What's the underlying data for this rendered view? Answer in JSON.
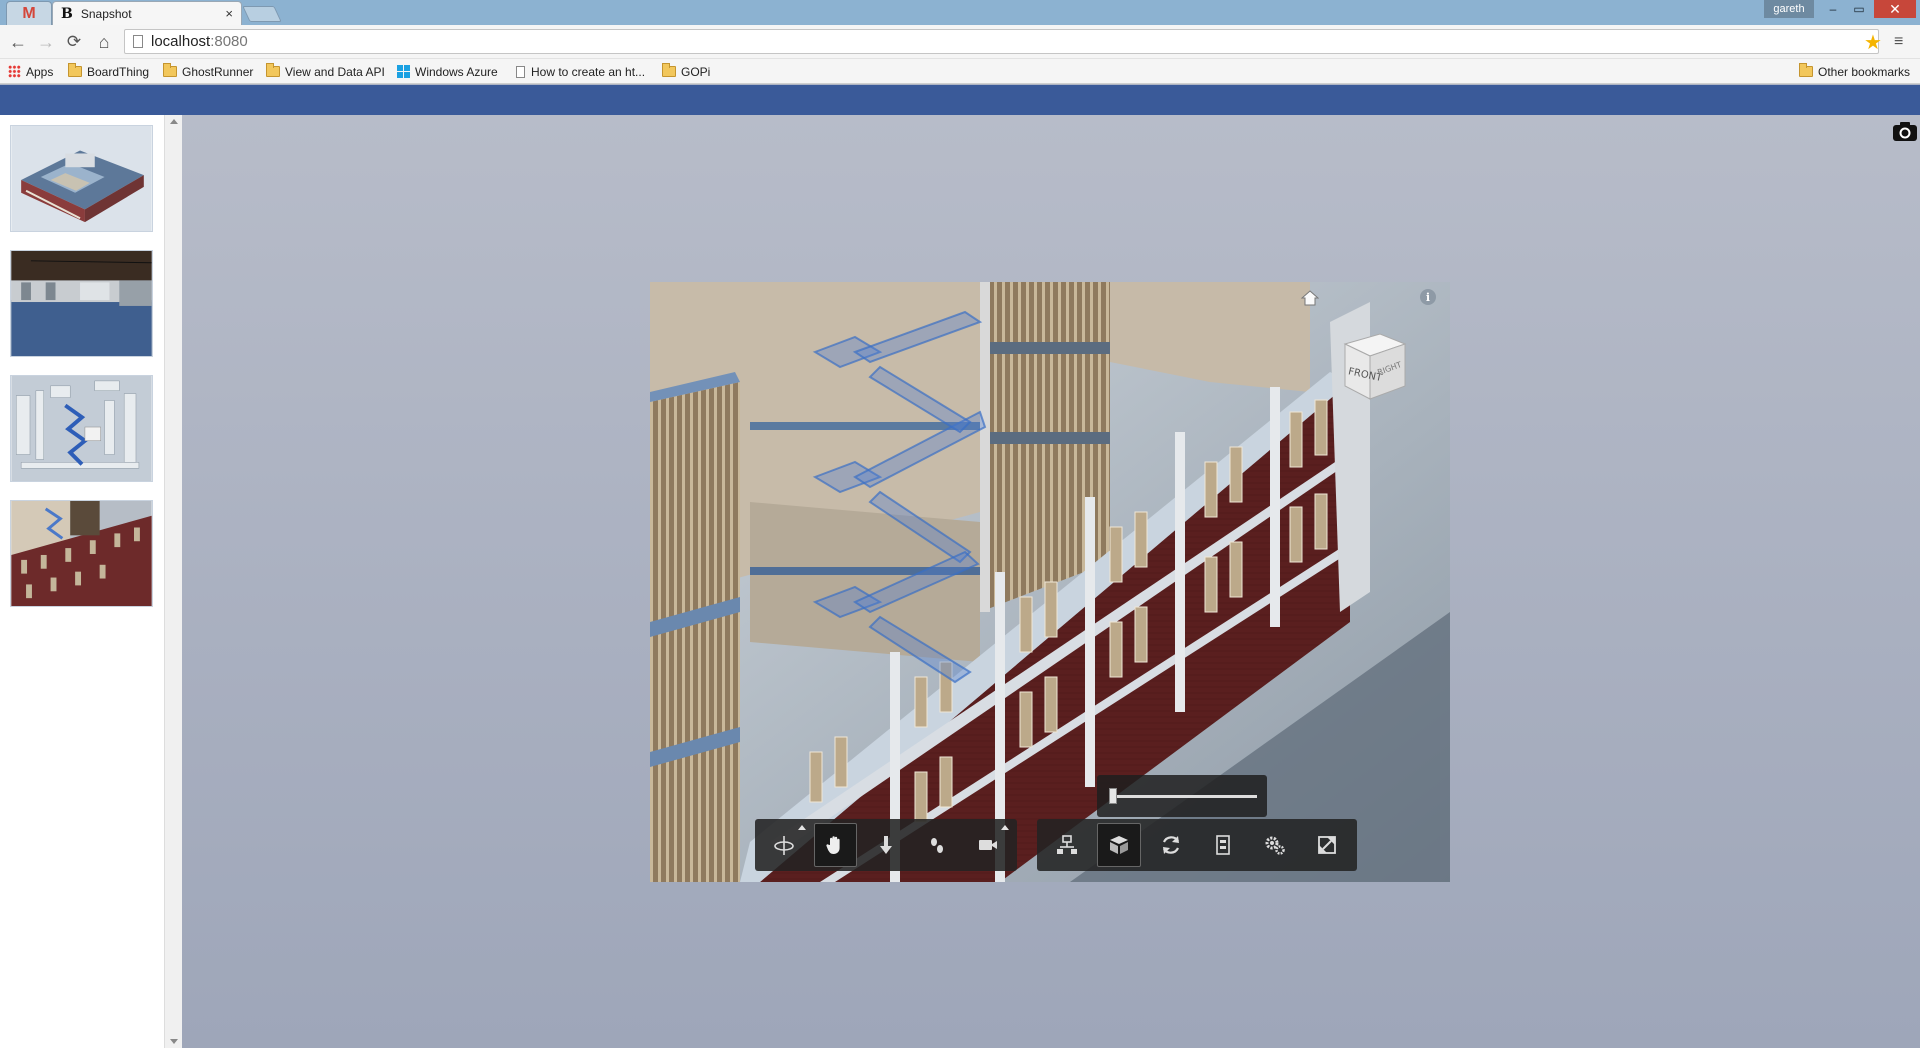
{
  "browser": {
    "tabs": [
      {
        "icon": "gmail-icon",
        "title": "M"
      },
      {
        "icon": "snapshot-favicon",
        "favicon": "B",
        "title": "Snapshot",
        "close": "×"
      }
    ],
    "profile_name": "gareth",
    "window_controls": {
      "minimize": "–",
      "restore": "▭",
      "close": "✕"
    },
    "url": {
      "host": "localhost",
      "port": ":8080"
    },
    "bookmarks": [
      {
        "icon": "apps-grid-icon",
        "label": "Apps"
      },
      {
        "icon": "folder-icon",
        "label": "BoardThing"
      },
      {
        "icon": "folder-icon",
        "label": "GhostRunner"
      },
      {
        "icon": "folder-icon",
        "label": "View and Data API"
      },
      {
        "icon": "windows-logo-icon",
        "label": "Windows Azure"
      },
      {
        "icon": "page-icon",
        "label": "How to create an ht..."
      },
      {
        "icon": "folder-icon",
        "label": "GOPi"
      },
      {
        "icon": "folder-icon",
        "label": "Other bookmarks"
      }
    ],
    "nav_icons": {
      "back": "←",
      "forward": "→",
      "reload": "⟳",
      "home": "⌂",
      "star": "★",
      "menu": "≡"
    }
  },
  "app": {
    "snapshots": [
      {
        "name": "snapshot-1",
        "view": "aerial building overview"
      },
      {
        "name": "snapshot-2",
        "view": "interior floor"
      },
      {
        "name": "snapshot-3",
        "view": "stair structure"
      },
      {
        "name": "snapshot-4",
        "view": "facade with stairs"
      }
    ],
    "viewer": {
      "viewcube_faces": {
        "front": "FRONT",
        "right": "RIGHT"
      },
      "info_label": "i",
      "explode_slider_value": 0.0,
      "toolbar_left": [
        {
          "name": "orbit-tool",
          "icon": "orbit-icon",
          "has_flyout": true,
          "active": false
        },
        {
          "name": "pan-tool",
          "icon": "hand-icon",
          "has_flyout": false,
          "active": true
        },
        {
          "name": "zoom-tool",
          "icon": "zoom-arrow-icon",
          "has_flyout": false,
          "active": false
        },
        {
          "name": "first-person-tool",
          "icon": "walk-icon",
          "has_flyout": false,
          "active": false
        },
        {
          "name": "camera-tool",
          "icon": "video-camera-icon",
          "has_flyout": true,
          "active": false
        }
      ],
      "toolbar_right": [
        {
          "name": "model-structure-tool",
          "icon": "structure-icon",
          "active": false
        },
        {
          "name": "explode-tool",
          "icon": "explode-cube-icon",
          "active": true
        },
        {
          "name": "reset-tool",
          "icon": "refresh-icon",
          "active": false
        },
        {
          "name": "properties-tool",
          "icon": "properties-icon",
          "active": false
        },
        {
          "name": "settings-tool",
          "icon": "gears-icon",
          "active": false
        },
        {
          "name": "fullscreen-tool",
          "icon": "fullscreen-icon",
          "active": false
        }
      ]
    }
  },
  "colors": {
    "app_header": "#3a5a99",
    "background": "#adb4c4",
    "tab_strip": "#8cb2d1"
  }
}
